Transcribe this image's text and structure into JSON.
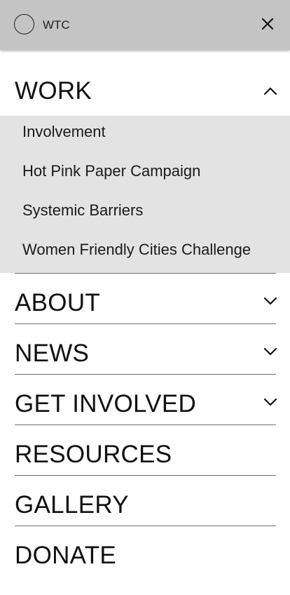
{
  "header": {
    "logo_text": "WTC",
    "logo_icon": "circle-logo-icon",
    "close_icon": "close-icon"
  },
  "menu": {
    "work": {
      "label": "WORK",
      "expanded": true,
      "icon": "chevron-up-icon",
      "items": [
        {
          "label": "Involvement"
        },
        {
          "label": "Hot Pink Paper Campaign"
        },
        {
          "label": "Systemic Barriers"
        },
        {
          "label": "Women Friendly Cities Challenge"
        }
      ]
    },
    "rows": [
      {
        "label": "ABOUT",
        "icon": "chevron-down-icon"
      },
      {
        "label": "NEWS",
        "icon": "chevron-down-icon"
      },
      {
        "label": "GET INVOLVED",
        "icon": "chevron-down-icon"
      },
      {
        "label": "RESOURCES"
      },
      {
        "label": "GALLERY"
      },
      {
        "label": "DONATE"
      }
    ]
  },
  "colors": {
    "header_bg": "#c4c4c4",
    "submenu_bg": "#e3e3e3",
    "divider": "#6f6f6f",
    "text": "#111111"
  }
}
